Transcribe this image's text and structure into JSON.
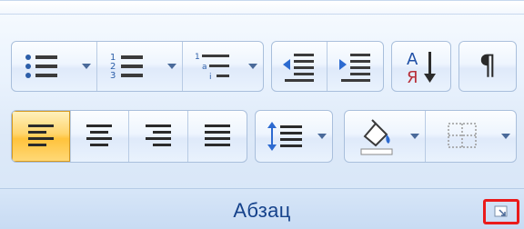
{
  "group": {
    "label": "Абзац"
  },
  "icons": {
    "bullets": "bullet-list-icon",
    "numbering": "numbered-list-icon",
    "multilevel": "multilevel-list-icon",
    "decrease_indent": "decrease-indent-icon",
    "increase_indent": "increase-indent-icon",
    "sort": "sort-icon",
    "show_marks": "pilcrow-icon",
    "align_left": "align-left-icon",
    "align_center": "align-center-icon",
    "align_right": "align-right-icon",
    "justify": "justify-icon",
    "line_spacing": "line-spacing-icon",
    "shading": "paint-bucket-icon",
    "borders": "borders-icon",
    "launcher": "dialog-launcher-icon"
  },
  "sort_letters": {
    "top": "A",
    "bottom": "Я"
  },
  "colors": {
    "label": "#15428b",
    "active_fill": "#ffd56d",
    "highlight_box": "#ea1b1b"
  }
}
